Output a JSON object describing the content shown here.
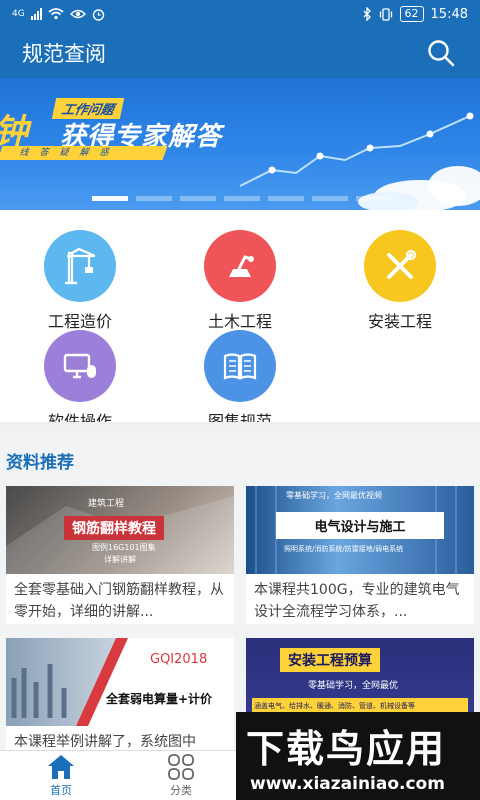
{
  "status_bar": {
    "network": "4G",
    "battery": "62",
    "time": "15:48"
  },
  "header": {
    "title": "规范查阅"
  },
  "banner": {
    "big_text": "钟",
    "tag": "工作问题",
    "main": "获得专家解答",
    "strip": "线答疑解惑",
    "active_dot": 0,
    "dot_count": 7
  },
  "categories": [
    {
      "label": "工程造价",
      "icon": "crane-icon",
      "color": "#5cb8ef"
    },
    {
      "label": "土木工程",
      "icon": "excavator-icon",
      "color": "#ef5458"
    },
    {
      "label": "安装工程",
      "icon": "tools-icon",
      "color": "#f7c61f"
    },
    {
      "label": "软件操作",
      "icon": "computer-mouse-icon",
      "color": "#9b7fd9"
    },
    {
      "label": "图集规范",
      "icon": "book-icon",
      "color": "#4c93e6"
    }
  ],
  "recommend": {
    "title": "资料推荐",
    "cards": [
      {
        "img_title": "钢筋翻样教程",
        "img_sub1": "建筑工程",
        "img_sub2": "图例16G101图集",
        "img_sub3": "详解讲解",
        "text": "全套零基础入门钢筋翻样教程，从零开始，详细的讲解..."
      },
      {
        "img_title": "电气设计与施工",
        "img_sub1": "零基础学习，全网最优视频",
        "img_sub2": "照明系统/消防系统/防雷接地/弱电系统",
        "text": "本课程共100G，专业的建筑电气设计全流程学习体系，..."
      },
      {
        "img_title": "全套弱电算量+计价",
        "img_sub1": "GQI2018",
        "text": "本课程举例讲解了，系统图中"
      },
      {
        "img_title": "安装工程预算",
        "img_sub1": "零基础学习，全网最优",
        "img_sub2": "涵盖电气、给排水、暖通、消防、管道、机械设备等",
        "text": ""
      }
    ]
  },
  "bottom_nav": [
    {
      "label": "首页",
      "icon": "home-icon",
      "active": true
    },
    {
      "label": "分类",
      "icon": "grid-icon",
      "active": false
    }
  ],
  "watermark": {
    "title": "下载鸟应用",
    "url": "www.xiazainiao.com"
  },
  "colors": {
    "primary": "#1a6fb8",
    "accent": "#ffd23a"
  }
}
